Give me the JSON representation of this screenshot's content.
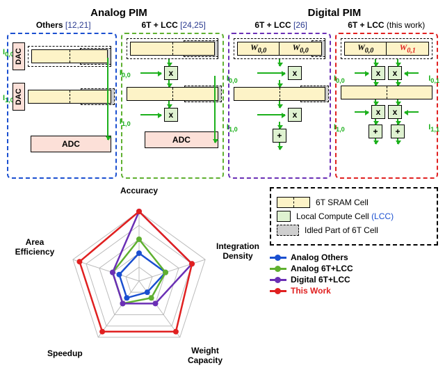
{
  "headers": {
    "analog": "Analog PIM",
    "digital": "Digital PIM"
  },
  "columns": {
    "c0": {
      "title": "Others",
      "refs": "[12,21]"
    },
    "c1": {
      "title": "6T + LCC",
      "refs": "[24,25]"
    },
    "c2": {
      "title": "6T + LCC",
      "refs": "[26]"
    },
    "c3": {
      "title": "6T + LCC",
      "refs": "(this work)"
    }
  },
  "io": {
    "i00": "I",
    "i00_sub": "0,0",
    "i10": "I",
    "i10_sub": "1,0",
    "i01": "I",
    "i01_sub": "0,1",
    "i11": "I",
    "i11_sub": "1,1"
  },
  "blocks": {
    "dac": "DAC",
    "adc": "ADC",
    "mul": "x",
    "add": "+"
  },
  "weights": {
    "w00": "W",
    "w00_sub": "0,0",
    "w01": "W",
    "w01_sub": "0,1"
  },
  "legend": {
    "sram": "6T SRAM Cell",
    "lcc_full": "Local Compute Cell ",
    "lcc_short": "(LCC)",
    "idled": "Idled Part of 6T Cell"
  },
  "radar": {
    "axes": [
      "Accuracy",
      "Integration\nDensity",
      "Weight\nCapacity",
      "Speedup",
      "Area\nEfficiency"
    ],
    "ax0": "Accuracy",
    "ax1": "Integration Density",
    "ax2": "Weight Capacity",
    "ax3": "Speedup",
    "ax4": "Area Efficiency"
  },
  "series": {
    "s0": "Analog Others",
    "s1": "Analog 6T+LCC",
    "s2": "Digital 6T+LCC",
    "s3": "This Work"
  },
  "chart_data": {
    "type": "radar",
    "axes": [
      "Accuracy",
      "Integration Density",
      "Weight Capacity",
      "Speedup",
      "Area Efficiency"
    ],
    "scale": {
      "min": 0,
      "max": 5,
      "rings": 5
    },
    "series": [
      {
        "name": "Analog Others",
        "color": "#1a4fd0",
        "values": [
          2.0,
          2.0,
          1.0,
          1.5,
          1.5
        ]
      },
      {
        "name": "Analog 6T+LCC",
        "color": "#5fb030",
        "values": [
          3.0,
          2.0,
          1.5,
          2.0,
          2.0
        ]
      },
      {
        "name": "Digital 6T+LCC",
        "color": "#6a2fb5",
        "values": [
          5.0,
          4.0,
          2.0,
          2.0,
          2.0
        ]
      },
      {
        "name": "This Work",
        "color": "#e02020",
        "values": [
          5.0,
          4.0,
          4.5,
          4.5,
          4.5
        ]
      }
    ]
  }
}
